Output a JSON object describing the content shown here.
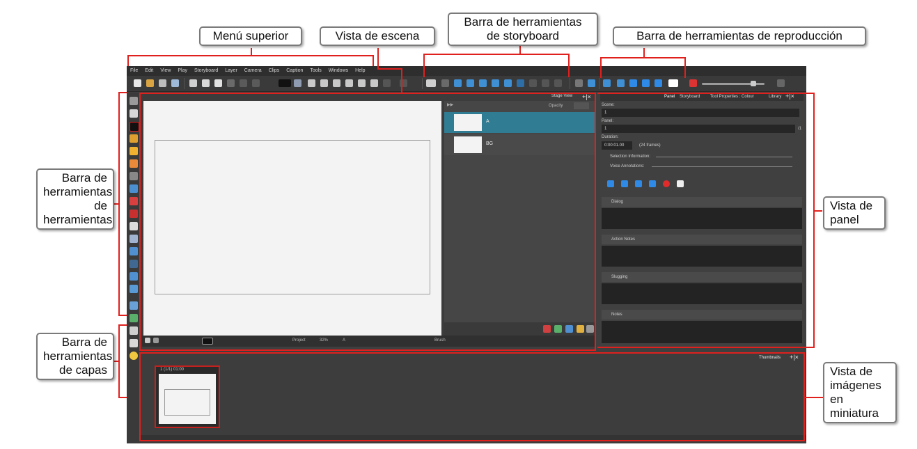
{
  "app": {
    "menu": [
      "File",
      "Edit",
      "View",
      "Play",
      "Storyboard",
      "Layer",
      "Camera",
      "Clips",
      "Caption",
      "Tools",
      "Windows",
      "Help"
    ],
    "stage": {
      "title": "Stage View",
      "opacity_label": "Opacity",
      "layers": [
        {
          "name": "A",
          "selected": true
        },
        {
          "name": "BG",
          "selected": false
        }
      ],
      "bottom_project": "Project",
      "bottom_zoom": "32%",
      "bottom_layer": "A",
      "bottom_tool": "Brush"
    },
    "panel_view": {
      "tabs": [
        "Panel",
        "Storyboard",
        "Tool Properties : Colour",
        "Library"
      ],
      "scene_label": "Scene:",
      "scene_value": "1",
      "panel_label": "Panel:",
      "panel_value": "1",
      "panel_total": "/1",
      "duration_label": "Duration:",
      "duration_value": "0:00:01.00",
      "duration_frames": "(24 frames)",
      "selection_info": "Selection Information:",
      "voice_annotations": "Voice Annotations:",
      "sections": [
        "Dialog",
        "Action Notes",
        "Slugging",
        "Notes"
      ]
    },
    "thumbnails": {
      "title": "Thumbnails",
      "items": [
        {
          "label": "1 (1/1) 01:00"
        }
      ]
    }
  },
  "callouts": {
    "menu": "Menú superior",
    "scene": "Vista de escena",
    "storyboard": "Barra de herramientas\nde storyboard",
    "playback": "Barra de herramientas de reproducción",
    "tools": "Barra de\nherramientas\nde\nherramientas",
    "panel": "Vista de\npanel",
    "layers": "Barra de\nherramientas\nde capas",
    "thumbs": "Vista de\nimágenes\nen\nminiatura"
  },
  "colors": {
    "highlight_red": "#e0201d",
    "selected_layer": "#2f7c93",
    "transport_blue": "#2e8ae6"
  }
}
